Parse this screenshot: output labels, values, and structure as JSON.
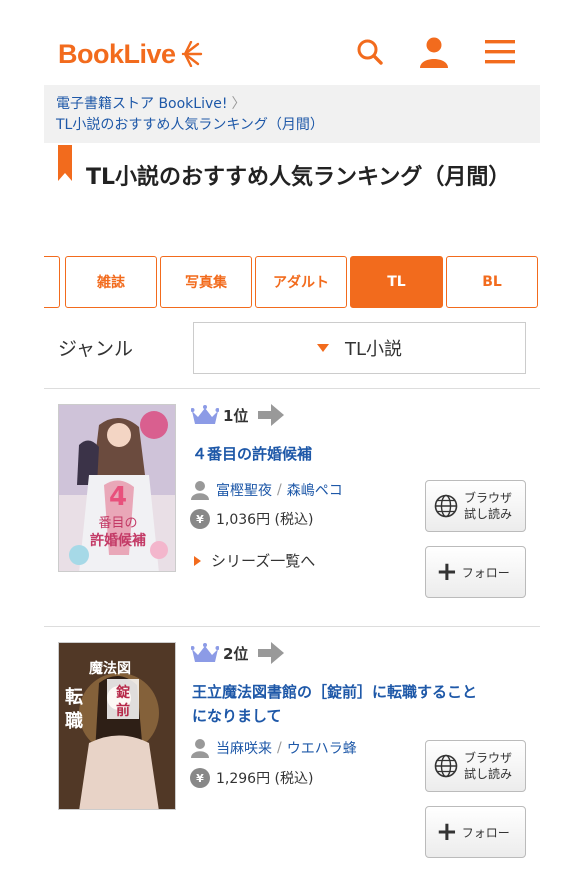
{
  "header": {
    "logo": "BookLive",
    "icons": [
      "search-icon",
      "user-icon",
      "menu-icon"
    ],
    "brand_color": "#f26b1d"
  },
  "breadcrumb": {
    "items": [
      "電子書籍ストア BookLive!",
      "TL小説のおすすめ人気ランキング（月間）"
    ]
  },
  "page_title": "TL小説のおすすめ人気ランキング（月間）",
  "tabs": [
    {
      "label": "雑誌",
      "active": false
    },
    {
      "label": "写真集",
      "active": false
    },
    {
      "label": "アダルト",
      "active": false
    },
    {
      "label": "TL",
      "active": true
    },
    {
      "label": "BL",
      "active": false
    }
  ],
  "genre": {
    "label": "ジャンル",
    "selected": "TL小説"
  },
  "ranking": [
    {
      "rank": "1位",
      "title": "４番目の許婚候補",
      "authors": [
        "富樫聖夜",
        "森嶋ペコ"
      ],
      "price": "1,036円 (税込)",
      "series_link": "シリーズ一覧へ",
      "browse_label_1": "ブラウザ",
      "browse_label_2": "試し読み",
      "follow_label": "フォロー"
    },
    {
      "rank": "2位",
      "title_line_1": "王立魔法図書館の［錠前］に転職すること",
      "title_line_2": "になりまして",
      "authors": [
        "当麻咲来",
        "ウエハラ蜂"
      ],
      "price": "1,296円 (税込)",
      "browse_label_1": "ブラウザ",
      "browse_label_2": "試し読み",
      "follow_label": "フォロー"
    }
  ]
}
